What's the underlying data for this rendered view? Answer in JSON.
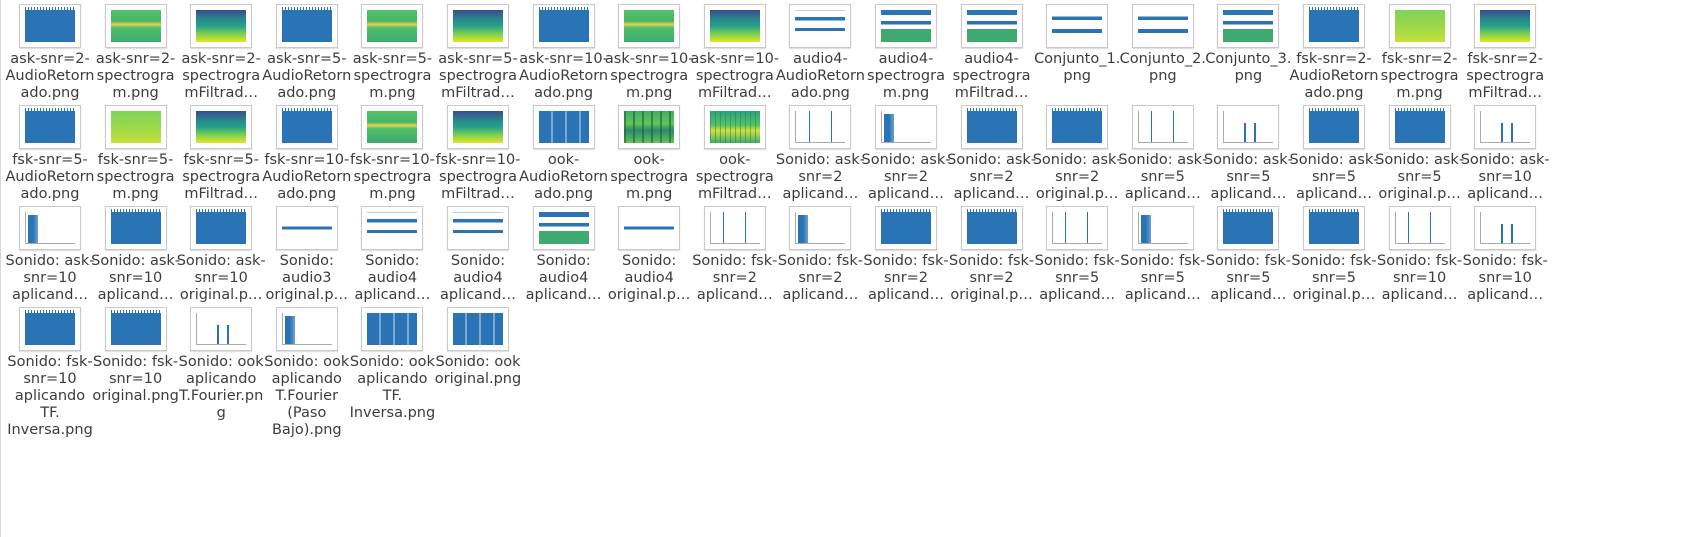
{
  "colors": {
    "accent": "#2a73b5",
    "label": "#3c3c3c",
    "background": "#ffffff"
  },
  "files": [
    {
      "name": "ask-snr=2-AudioRetornado.png",
      "thumb": "t-audio"
    },
    {
      "name": "ask-snr=2-spectrogram.png",
      "thumb": "t-spec-green"
    },
    {
      "name": "ask-snr=2-spectrogramFiltrad…",
      "thumb": "t-spec-filt"
    },
    {
      "name": "ask-snr=5-AudioRetornado.png",
      "thumb": "t-audio"
    },
    {
      "name": "ask-snr=5-spectrogram.png",
      "thumb": "t-spec-green"
    },
    {
      "name": "ask-snr=5-spectrogramFiltrad…",
      "thumb": "t-spec-filt"
    },
    {
      "name": "ask-snr=10-AudioRetornado.png",
      "thumb": "t-audio"
    },
    {
      "name": "ask-snr=10-spectrogram.png",
      "thumb": "t-spec-green"
    },
    {
      "name": "ask-snr=10-spectrogramFiltrad…",
      "thumb": "t-spec-filt"
    },
    {
      "name": "audio4-AudioRetornado.png",
      "thumb": "t-multi"
    },
    {
      "name": "audio4-spectrogram.png",
      "thumb": "t-multi-spec"
    },
    {
      "name": "audio4-spectrogramFiltrad…",
      "thumb": "t-multi-spec"
    },
    {
      "name": "Conjunto_1.png",
      "thumb": "t-line2"
    },
    {
      "name": "Conjunto_2.png",
      "thumb": "t-line2"
    },
    {
      "name": "Conjunto_3.png",
      "thumb": "t-multi-spec"
    },
    {
      "name": "fsk-snr=2-AudioRetornado.png",
      "thumb": "t-audio"
    },
    {
      "name": "fsk-snr=2-spectrogram.png",
      "thumb": "t-spec-green2"
    },
    {
      "name": "fsk-snr=2-spectrogramFiltrad…",
      "thumb": "t-spec-filt"
    },
    {
      "name": "fsk-snr=5-AudioRetornado.png",
      "thumb": "t-audio"
    },
    {
      "name": "fsk-snr=5-spectrogram.png",
      "thumb": "t-spec-green2"
    },
    {
      "name": "fsk-snr=5-spectrogramFiltrad…",
      "thumb": "t-spec-filt"
    },
    {
      "name": "fsk-snr=10-AudioRetornado.png",
      "thumb": "t-audio"
    },
    {
      "name": "fsk-snr=10-spectrogram.png",
      "thumb": "t-spec-green"
    },
    {
      "name": "fsk-snr=10-spectrogramFiltrad…",
      "thumb": "t-spec-filt"
    },
    {
      "name": "ook-AudioRetornado.png",
      "thumb": "t-ook"
    },
    {
      "name": "ook-spectrogram.png",
      "thumb": "t-spec-ook"
    },
    {
      "name": "ook-spectrogramFiltrad…",
      "thumb": "t-spec-ook-filt"
    },
    {
      "name": "Sonido: ask-snr=2 aplicand…",
      "thumb": "t-spikes"
    },
    {
      "name": "Sonido: ask-snr=2 aplicand…",
      "thumb": "t-lowpass"
    },
    {
      "name": "Sonido: ask-snr=2 aplicand…",
      "thumb": "t-audio"
    },
    {
      "name": "Sonido: ask-snr=2 original.p…",
      "thumb": "t-audio"
    },
    {
      "name": "Sonido: ask-snr=5 aplicand…",
      "thumb": "t-spikes"
    },
    {
      "name": "Sonido: ask-snr=5 aplicand…",
      "thumb": "t-peak"
    },
    {
      "name": "Sonido: ask-snr=5 aplicand…",
      "thumb": "t-audio"
    },
    {
      "name": "Sonido: ask-snr=5 original.p…",
      "thumb": "t-audio"
    },
    {
      "name": "Sonido: ask-snr=10 aplicand…",
      "thumb": "t-peak"
    },
    {
      "name": "Sonido: ask-snr=10 aplicand…",
      "thumb": "t-lowpass"
    },
    {
      "name": "Sonido: ask-snr=10 aplicand…",
      "thumb": "t-audio"
    },
    {
      "name": "Sonido: ask-snr=10 original.p…",
      "thumb": "t-audio"
    },
    {
      "name": "Sonido: audio3 original.p…",
      "thumb": "t-line"
    },
    {
      "name": "Sonido: audio4 aplicand…",
      "thumb": "t-multi"
    },
    {
      "name": "Sonido: audio4 aplicand…",
      "thumb": "t-multi"
    },
    {
      "name": "Sonido: audio4 aplicand…",
      "thumb": "t-multi-spec"
    },
    {
      "name": "Sonido: audio4 original.p…",
      "thumb": "t-line"
    },
    {
      "name": "Sonido: fsk-snr=2 aplicand…",
      "thumb": "t-spikes"
    },
    {
      "name": "Sonido: fsk-snr=2 aplicand…",
      "thumb": "t-lowpass"
    },
    {
      "name": "Sonido: fsk-snr=2 aplicand…",
      "thumb": "t-audio"
    },
    {
      "name": "Sonido: fsk-snr=2 original.p…",
      "thumb": "t-audio"
    },
    {
      "name": "Sonido: fsk-snr=5 aplicand…",
      "thumb": "t-spikes"
    },
    {
      "name": "Sonido: fsk-snr=5 aplicand…",
      "thumb": "t-lowpass"
    },
    {
      "name": "Sonido: fsk-snr=5 aplicand…",
      "thumb": "t-audio"
    },
    {
      "name": "Sonido: fsk-snr=5 original.p…",
      "thumb": "t-audio"
    },
    {
      "name": "Sonido: fsk-snr=10 aplicand…",
      "thumb": "t-spikes"
    },
    {
      "name": "Sonido: fsk-snr=10 aplicand…",
      "thumb": "t-peak"
    },
    {
      "name": "Sonido: fsk-snr=10 aplicando TF. Inversa.png",
      "thumb": "t-audio",
      "full": true
    },
    {
      "name": "Sonido: fsk-snr=10 original.png",
      "thumb": "t-audio",
      "full": true
    },
    {
      "name": "Sonido: ook aplicando T.Fourier.png",
      "thumb": "t-peak",
      "full": true
    },
    {
      "name": "Sonido: ook aplicando T.Fourier (Paso Bajo).png",
      "thumb": "t-lowpass",
      "full": true
    },
    {
      "name": "Sonido: ook aplicando TF. Inversa.png",
      "thumb": "t-ook",
      "full": true
    },
    {
      "name": "Sonido: ook original.png",
      "thumb": "t-ook",
      "full": true
    }
  ]
}
